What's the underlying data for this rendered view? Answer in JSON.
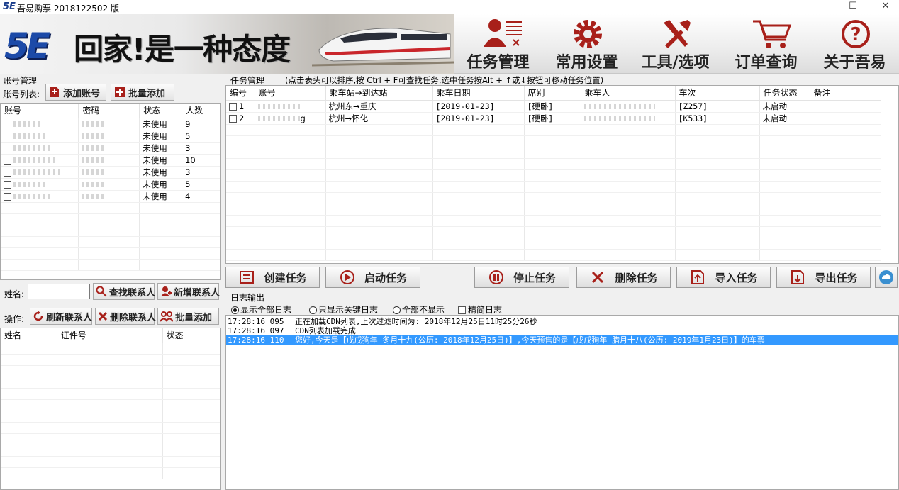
{
  "window": {
    "title": "吾易购票 2018122502  版",
    "min": "—",
    "max": "☐",
    "close": "✕"
  },
  "banner": {
    "logo_text": "5E",
    "slogan": "回家!是一种态度",
    "nav": [
      {
        "label": "任务管理",
        "icon": "task-manage-icon"
      },
      {
        "label": "常用设置",
        "icon": "gear-icon"
      },
      {
        "label": "工具/选项",
        "icon": "tools-icon"
      },
      {
        "label": "订单查询",
        "icon": "cart-icon"
      },
      {
        "label": "关于吾易",
        "icon": "question-icon"
      }
    ]
  },
  "accounts": {
    "section_title": "账号管理",
    "list_label": "账号列表:",
    "add_button": "添加账号",
    "batch_button": "批量添加",
    "columns": [
      "账号",
      "密码",
      "状态",
      "人数"
    ],
    "rows": [
      {
        "account": "",
        "password": "",
        "status": "未使用",
        "count": "9"
      },
      {
        "account": "",
        "password": "",
        "status": "未使用",
        "count": "5"
      },
      {
        "account": "",
        "password": "",
        "status": "未使用",
        "count": "3"
      },
      {
        "account": "",
        "password": "",
        "status": "未使用",
        "count": "10"
      },
      {
        "account": "",
        "password": "",
        "status": "未使用",
        "count": "3"
      },
      {
        "account": "",
        "password": "",
        "status": "未使用",
        "count": "5"
      },
      {
        "account": "",
        "password": "",
        "status": "未使用",
        "count": "4"
      }
    ]
  },
  "contacts": {
    "name_label": "姓名:",
    "name_value": "",
    "find_button": "查找联系人",
    "new_button": "新增联系人",
    "op_label": "操作:",
    "refresh_button": "刷新联系人",
    "delete_button": "删除联系人",
    "batch_button": "批量添加",
    "columns": [
      "姓名",
      "证件号",
      "状态"
    ]
  },
  "tasks": {
    "section_title": "任务管理",
    "hint": "(点击表头可以排序,按 Ctrl + F可查找任务,选中任务按Alt + ↑或↓按钮可移动任务位置)",
    "columns": [
      "编号",
      "账号",
      "乘车站→到达站",
      "乘车日期",
      "席别",
      "乘车人",
      "车次",
      "任务状态",
      "备注"
    ],
    "rows": [
      {
        "no": "1",
        "account": "",
        "route": "杭州东→重庆",
        "date": "[2019-01-23]",
        "seat": "[硬卧]",
        "passenger": "",
        "train": "[Z257]",
        "status": "未启动",
        "note": ""
      },
      {
        "no": "2",
        "account": "g",
        "route": "杭州→怀化",
        "date": "[2019-01-23]",
        "seat": "[硬卧]",
        "passenger": "",
        "train": "[K533]",
        "status": "未启动",
        "note": ""
      }
    ],
    "buttons": {
      "create": "创建任务",
      "start": "启动任务",
      "stop": "停止任务",
      "delete": "删除任务",
      "import": "导入任务",
      "export": "导出任务"
    }
  },
  "log": {
    "section_title": "日志输出",
    "options": [
      {
        "label": "显示全部日志",
        "checked": true
      },
      {
        "label": "只显示关键日志",
        "checked": false
      },
      {
        "label": "全部不显示",
        "checked": false
      }
    ],
    "simple_label": "精简日志",
    "lines": [
      {
        "time": "17:28:16 095",
        "text": "正在加载CDN列表,上次过滤时间为: 2018年12月25日11时25分26秒"
      },
      {
        "time": "17:28:16 097",
        "text": "CDN列表加载完成"
      },
      {
        "time": "17:28:16 110",
        "text": "您好,今天是【戊戌狗年 冬月十九(公历: 2018年12月25日)】,今天预售的是【戊戌狗年 腊月十八(公历: 2019年1月23日)】的车票",
        "selected": true
      }
    ]
  },
  "colors": {
    "accent": "#1c4aa8",
    "icon_red": "#a8201a",
    "selection": "#3399ff"
  }
}
